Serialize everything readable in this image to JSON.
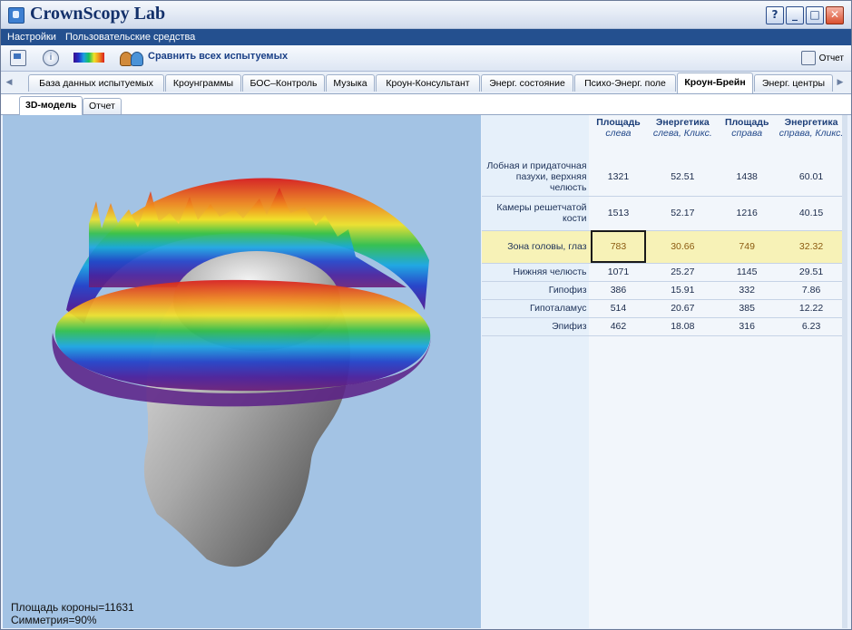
{
  "window": {
    "title": "CrownScopy Lab",
    "help": "?",
    "minimize": "_",
    "maximize": "□",
    "close": "✕"
  },
  "menu": [
    "Настройки",
    "Пользовательские средства"
  ],
  "toolbar": {
    "compare_label": "Сравнить всех испытуемых",
    "report_label": "Отчет"
  },
  "tabs": [
    {
      "label": "База данных испытуемых"
    },
    {
      "label": "Кроунграммы"
    },
    {
      "label": "БОС–Контроль"
    },
    {
      "label": "Музыка"
    },
    {
      "label": "Кроун-Консультант"
    },
    {
      "label": "Энерг. состояние"
    },
    {
      "label": "Психо-Энерг. поле"
    },
    {
      "label": "Кроун-Брейн",
      "active": true
    },
    {
      "label": "Энерг. центры"
    }
  ],
  "subtabs": [
    {
      "label": "3D-модель",
      "active": true
    },
    {
      "label": "Отчет"
    }
  ],
  "view": {
    "area_text": "Площадь короны=11631",
    "symmetry_text": "Симметрия=90%"
  },
  "table": {
    "headers": [
      {
        "title": "Площадь",
        "sub": "слева"
      },
      {
        "title": "Энергетика",
        "sub": "слева, Кликс."
      },
      {
        "title": "Площадь",
        "sub": "справа"
      },
      {
        "title": "Энергетика",
        "sub": "справа, Кликс."
      }
    ],
    "rows": [
      {
        "label": "Лобная и придаточная пазухи, верхняя челюсть",
        "values": [
          "1321",
          "52.51",
          "1438",
          "60.01"
        ]
      },
      {
        "label": "Камеры решетчатой кости",
        "values": [
          "1513",
          "52.17",
          "1216",
          "40.15"
        ]
      },
      {
        "label": "Зона головы, глаз",
        "values": [
          "783",
          "30.66",
          "749",
          "32.32"
        ],
        "highlight": true
      },
      {
        "label": "Нижняя челюсть",
        "values": [
          "1071",
          "25.27",
          "1145",
          "29.51"
        ]
      },
      {
        "label": "Гипофиз",
        "values": [
          "386",
          "15.91",
          "332",
          "7.86"
        ]
      },
      {
        "label": "Гипоталамус",
        "values": [
          "514",
          "20.67",
          "385",
          "12.22"
        ]
      },
      {
        "label": "Эпифиз",
        "values": [
          "462",
          "18.08",
          "316",
          "6.23"
        ]
      }
    ]
  },
  "colors": {
    "menubar": "#24508f",
    "viewport": "#a3c3e4",
    "highlight": "#f7f2b7"
  }
}
